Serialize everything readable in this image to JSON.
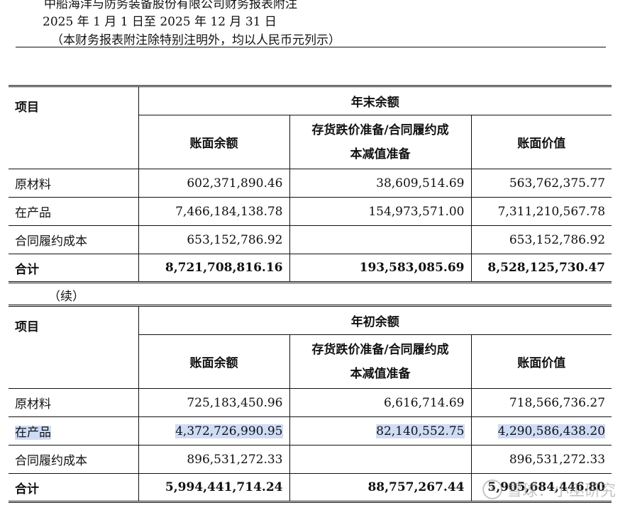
{
  "header": {
    "company_line": "中船海洋与防务装备股份有限公司财务报表附注",
    "period_line": "2025 年 1 月 1 日至 2025 年 12 月 31 日",
    "unit_note": "（本财务报表附注除特别注明外，均以人民币元列示）"
  },
  "table_end": {
    "group_header": "年末余额",
    "item_header": "项目",
    "col1": "账面余额",
    "col2_line1": "存货跌价准备/合同履约成",
    "col2_line2": "本减值准备",
    "col3": "账面价值",
    "rows": [
      {
        "item": "原材料",
        "v1": "602,371,890.46",
        "v2": "38,609,514.69",
        "v3": "563,762,375.77"
      },
      {
        "item": "在产品",
        "v1": "7,466,184,138.78",
        "v2": "154,973,571.00",
        "v3": "7,311,210,567.78"
      },
      {
        "item": "合同履约成本",
        "v1": "653,152,786.92",
        "v2": "",
        "v3": "653,152,786.92"
      }
    ],
    "total": {
      "item": "合计",
      "v1": "8,721,708,816.16",
      "v2": "193,583,085.69",
      "v3": "8,528,125,730.47"
    }
  },
  "continued_label": "（续）",
  "table_begin": {
    "group_header": "年初余额",
    "item_header": "项目",
    "col1": "账面余额",
    "col2_line1": "存货跌价准备/合同履约成",
    "col2_line2": "本减值准备",
    "col3": "账面价值",
    "rows": [
      {
        "item": "原材料",
        "v1": "725,183,450.96",
        "v2": "6,616,714.69",
        "v3": "718,566,736.27"
      },
      {
        "item": "在产品",
        "v1": "4,372,726,990.95",
        "v2": "82,140,552.75",
        "v3": "4,290,586,438.20"
      },
      {
        "item": "合同履约成本",
        "v1": "896,531,272.33",
        "v2": "",
        "v3": "896,531,272.33"
      }
    ],
    "total": {
      "item": "合计",
      "v1": "5,994,441,714.24",
      "v2": "88,757,267.44",
      "v3": "5,905,684,446.80"
    }
  },
  "watermark": {
    "icon": "snowball-icon",
    "text": "雪球：小巫研究"
  },
  "colors": {
    "highlight": "#cfdcf6",
    "text": "#111111"
  }
}
